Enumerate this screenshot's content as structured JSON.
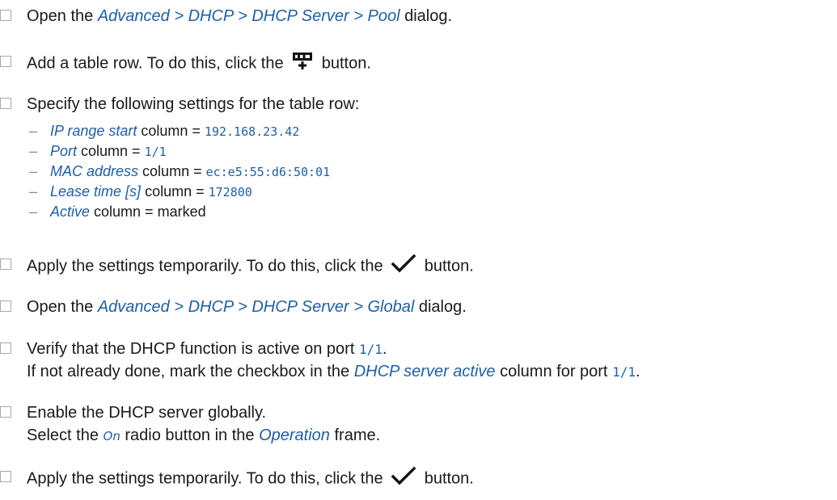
{
  "steps": [
    {
      "pre": "Open the ",
      "path": "Advanced > DHCP > DHCP Server > Pool",
      "post": " dialog."
    },
    {
      "pre": "Add a table row. To do this, click the ",
      "icon": "add-table-row-icon",
      "post": " button."
    },
    {
      "text": "Specify the following settings for the table row:",
      "settings": [
        {
          "label": "IP range start",
          "mid": " column = ",
          "value": "192.168.23.42"
        },
        {
          "label": "Port",
          "mid": " column = ",
          "value": "1/1"
        },
        {
          "label": "MAC address",
          "mid": " column = ",
          "value": "ec:e5:55:d6:50:01"
        },
        {
          "label": "Lease time [s]",
          "mid": " column = ",
          "value": "172800"
        },
        {
          "label": "Active",
          "mid": " column = marked",
          "value": ""
        }
      ]
    },
    {
      "pre": "Apply the settings temporarily. To do this, click the ",
      "icon": "checkmark-icon",
      "post": " button."
    },
    {
      "pre": "Open the ",
      "path": "Advanced > DHCP > DHCP Server > Global",
      "post": " dialog."
    },
    {
      "line1_pre": "Verify that the DHCP function is active on port ",
      "line1_value": "1/1",
      "line1_post": ".",
      "line2_pre": "If not already done, mark the checkbox in the ",
      "line2_field": "DHCP server active",
      "line2_mid": " column for port ",
      "line2_value": "1/1",
      "line2_post": "."
    },
    {
      "line1": "Enable the DHCP server globally.",
      "line2_pre": "Select the ",
      "line2_option": "On",
      "line2_mid": " radio button in the ",
      "line2_frame": "Operation",
      "line2_post": " frame."
    },
    {
      "pre": "Apply the settings temporarily. To do this, click the ",
      "icon": "checkmark-icon",
      "post": " button."
    }
  ]
}
